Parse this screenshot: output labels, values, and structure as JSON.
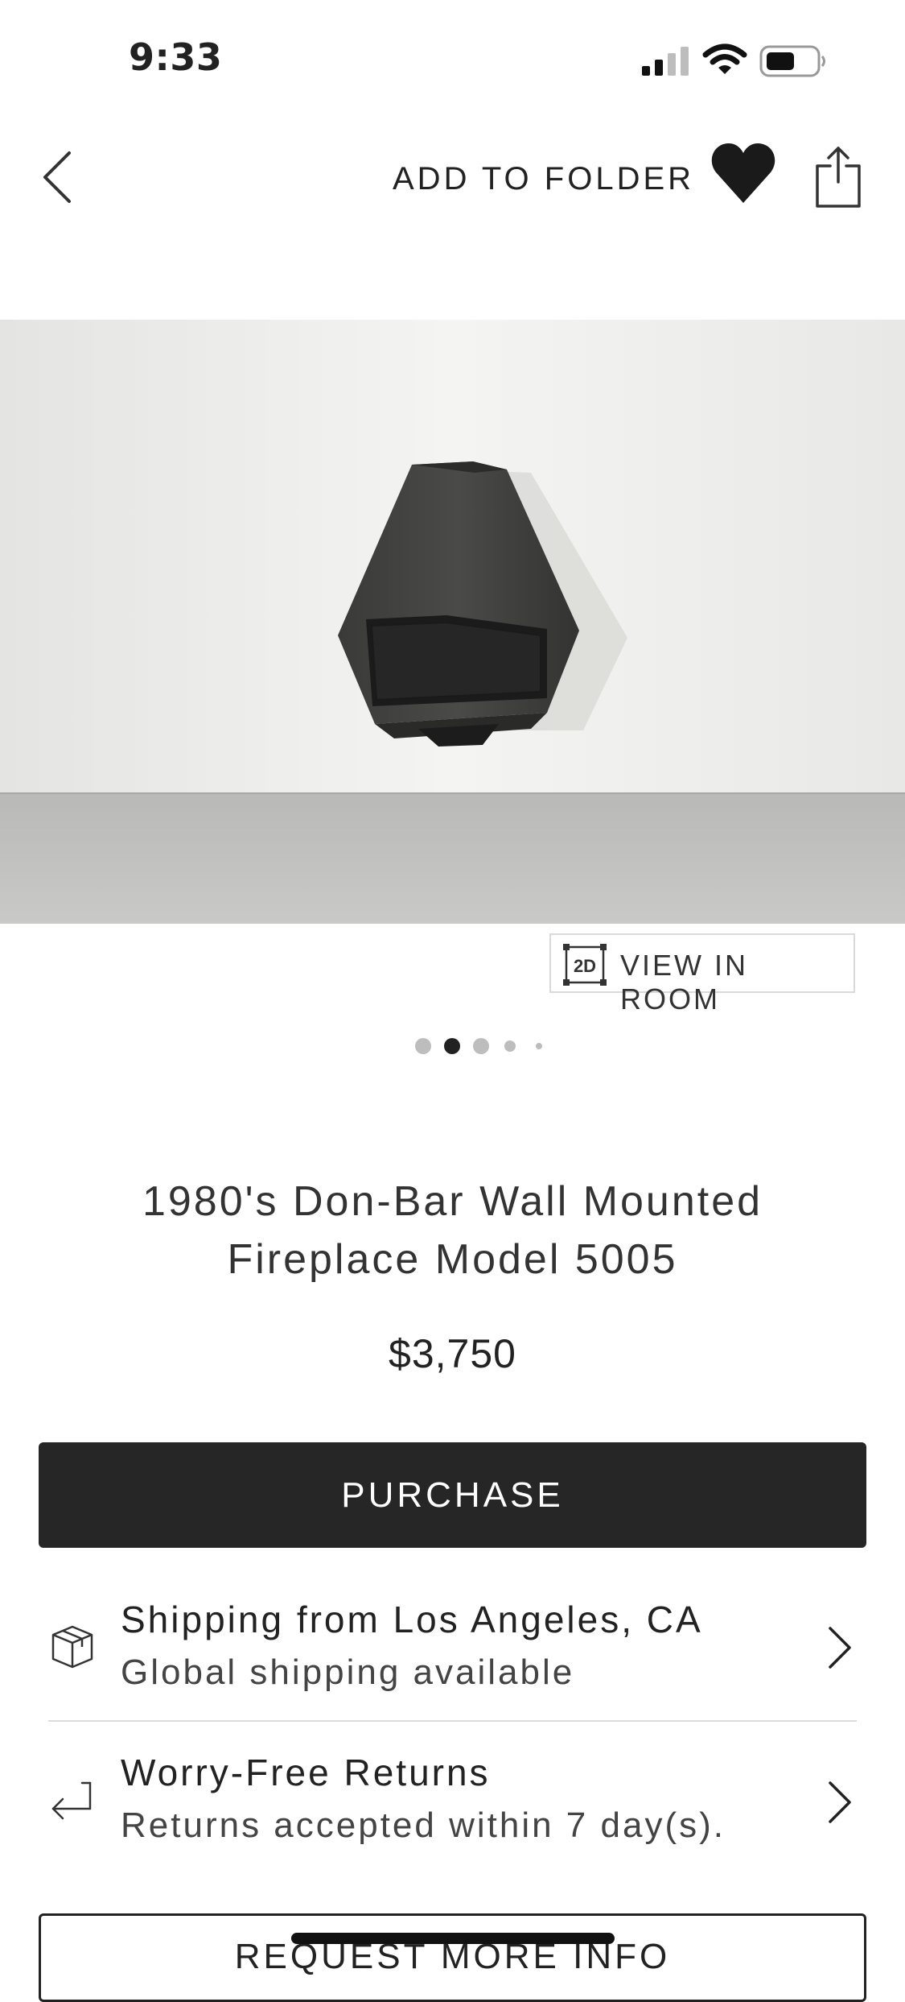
{
  "status_bar": {
    "time": "9:33",
    "icons": [
      "cellular-signal-icon",
      "wifi-icon",
      "battery-icon"
    ]
  },
  "nav": {
    "back_icon": "chevron-left-icon",
    "add_to_folder": "ADD TO FOLDER",
    "heart_icon": "heart-filled-icon",
    "share_icon": "share-icon"
  },
  "gallery": {
    "image_description_icon": "fireplace-photo",
    "view_in_room": "VIEW IN ROOM",
    "view_in_room_badge": "2D",
    "page_count": 5,
    "active_page": 2
  },
  "product": {
    "title_line1": "1980's Don-Bar Wall Mounted",
    "title_line2": "Fireplace Model 5005",
    "price": "$3,750",
    "purchase_label": "PURCHASE"
  },
  "info": {
    "shipping": {
      "icon": "package-box-icon",
      "title": "Shipping from Los Angeles, CA",
      "subtitle": "Global shipping available"
    },
    "returns": {
      "icon": "return-arrow-icon",
      "title": "Worry-Free Returns",
      "subtitle": "Returns accepted within 7 day(s)."
    }
  },
  "request_more_info": "REQUEST MORE INFO",
  "colors": {
    "text": "#222222",
    "purchase_bg": "#262626",
    "divider": "#dddddd",
    "dot_active": "#222222",
    "dot_inactive": "#bdbdbd"
  }
}
